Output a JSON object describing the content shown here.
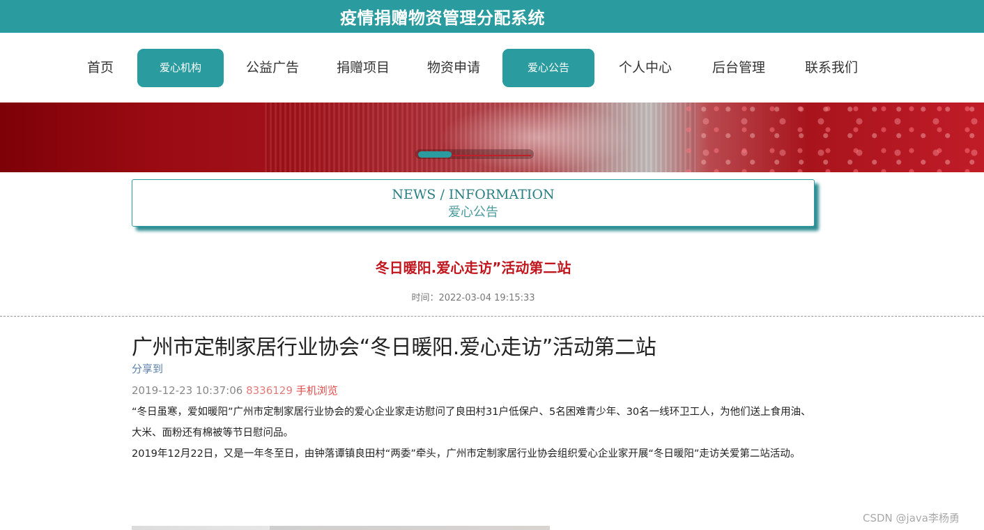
{
  "header": {
    "system_title": "疫情捐赠物资管理分配系统"
  },
  "nav": {
    "items": [
      {
        "label": "首页",
        "active": false
      },
      {
        "label": "爱心机构",
        "active": true
      },
      {
        "label": "公益广告",
        "active": false
      },
      {
        "label": "捐赠项目",
        "active": false
      },
      {
        "label": "物资申请",
        "active": false
      },
      {
        "label": "爱心公告",
        "active": true
      },
      {
        "label": "个人中心",
        "active": false
      },
      {
        "label": "后台管理",
        "active": false
      },
      {
        "label": "联系我们",
        "active": false
      }
    ]
  },
  "banner": {
    "carousel_active_index": 0
  },
  "section": {
    "en_title": "NEWS / INFORMATION",
    "cn_title": "爱心公告"
  },
  "article": {
    "title": "冬日暖阳.爱心走访”活动第二站",
    "time_label": "时间：",
    "time_value": "2022-03-04 19:15:33",
    "headline": "广州市定制家居行业协会“冬日暖阳.爱心走访”活动第二站",
    "share_label": "分享到",
    "meta_date": "2019-12-23 10:37:06",
    "meta_views": "8336129",
    "meta_mobile": "手机浏览",
    "paragraphs": [
      "“冬日虽寒，爱如暖阳”广州市定制家居行业协会的爱心企业家走访慰问了良田村31户低保户、5名困难青少年、30名一线环卫工人，为他们送上食用油、大米、面粉还有棉被等节日慰问品。",
      "2019年12月22日，又是一年冬至日，由钟落谭镇良田村“两委”牵头，广州市定制家居行业协会组织爱心企业家开展“冬日暖阳”走访关爱第二站活动。"
    ]
  },
  "watermark": "CSDN @java李杨勇",
  "colors": {
    "accent": "#2a9b9e",
    "title_red": "#c0171f"
  }
}
